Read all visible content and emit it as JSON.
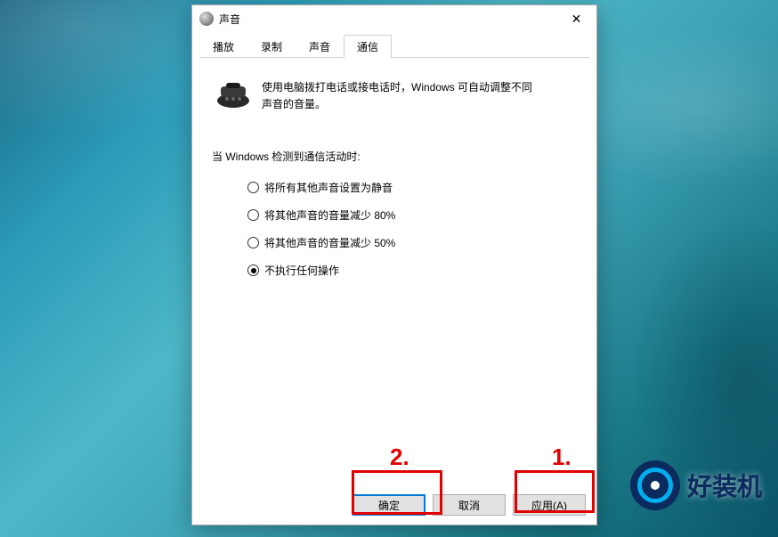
{
  "window": {
    "title": "声音",
    "close_glyph": "✕"
  },
  "tabs": {
    "items": [
      {
        "label": "播放",
        "active": false
      },
      {
        "label": "录制",
        "active": false
      },
      {
        "label": "声音",
        "active": false
      },
      {
        "label": "通信",
        "active": true
      }
    ]
  },
  "content": {
    "info_text": "使用电脑拨打电话或接电话时，Windows 可自动调整不同声音的音量。",
    "section_label": "当 Windows 检测到通信活动时:",
    "options": [
      {
        "label": "将所有其他声音设置为静音",
        "checked": false
      },
      {
        "label": "将其他声音的音量减少 80%",
        "checked": false
      },
      {
        "label": "将其他声音的音量减少 50%",
        "checked": false
      },
      {
        "label": "不执行任何操作",
        "checked": true
      }
    ]
  },
  "buttons": {
    "ok": "确定",
    "cancel": "取消",
    "apply": "应用(A)"
  },
  "annotations": {
    "label1": "1.",
    "label2": "2."
  },
  "watermark": {
    "text": "好装机"
  }
}
